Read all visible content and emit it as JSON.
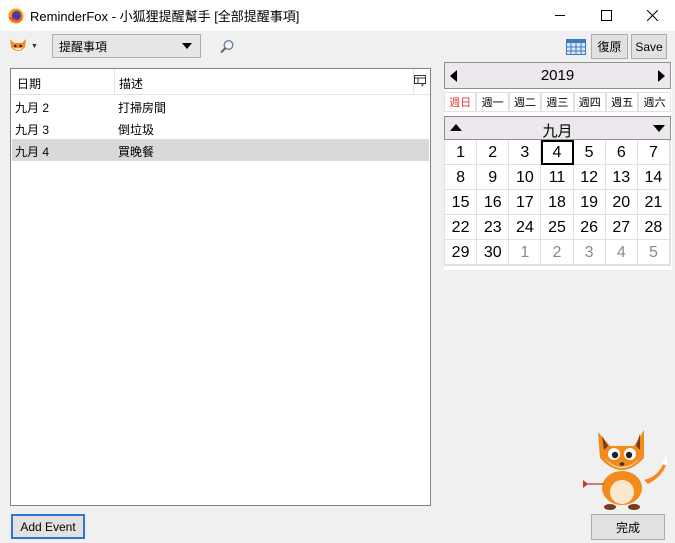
{
  "window": {
    "title": "ReminderFox - 小狐狸提醒幫手 [全部提醒事項]"
  },
  "toolbar": {
    "view_selected": "提醒事項",
    "restore_label": "復原",
    "save_label": "Save"
  },
  "list": {
    "columns": {
      "date": "日期",
      "description": "描述"
    },
    "rows": [
      {
        "date": "九月 2",
        "desc": "打掃房間"
      },
      {
        "date": "九月 3",
        "desc": "倒垃圾"
      },
      {
        "date": "九月 4",
        "desc": "買晚餐"
      }
    ]
  },
  "calendar": {
    "year": "2019",
    "month": "九月",
    "weekdays": [
      "週日",
      "週一",
      "週二",
      "週三",
      "週四",
      "週五",
      "週六"
    ],
    "days": [
      [
        "1",
        "2",
        "3",
        "4",
        "5",
        "6",
        "7"
      ],
      [
        "8",
        "9",
        "10",
        "11",
        "12",
        "13",
        "14"
      ],
      [
        "15",
        "16",
        "17",
        "18",
        "19",
        "20",
        "21"
      ],
      [
        "22",
        "23",
        "24",
        "25",
        "26",
        "27",
        "28"
      ],
      [
        "29",
        "30",
        "1",
        "2",
        "3",
        "4",
        "5"
      ]
    ],
    "today": "4"
  },
  "footer": {
    "add_event_label": "Add Event",
    "done_label": "完成"
  },
  "colors": {
    "accent": "#2f74cf",
    "sunday": "#e23a2e",
    "selected_row": "#d9d9d9"
  }
}
